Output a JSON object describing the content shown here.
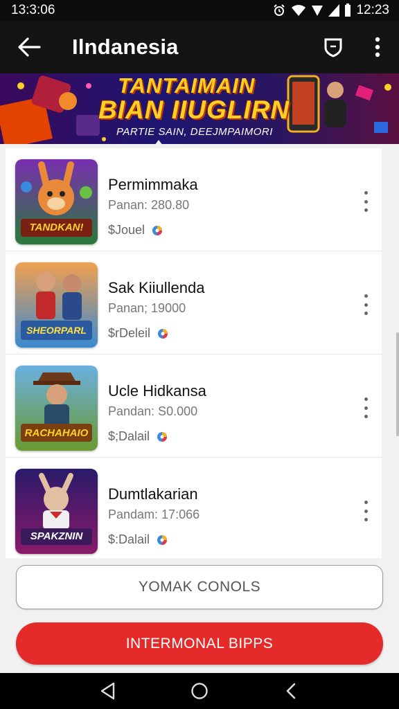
{
  "status_bar": {
    "time_left": "13:3:06",
    "time_right": "12:23",
    "icons": [
      "alarm-icon",
      "wifi-icon",
      "signal-icon",
      "signal-bars-icon",
      "battery-icon"
    ]
  },
  "app_bar": {
    "title": "Ilndanesia",
    "back_icon": "arrow-left-icon",
    "shield_icon": "shield-icon",
    "more_icon": "more-vertical-icon"
  },
  "banner": {
    "line1": "TANTAIMAIN",
    "line2": "BIAN IIUGLIRN",
    "line3": "PARTIE SAIN, DEEJMPAIMORI"
  },
  "games": [
    {
      "title": "Permimmaka",
      "subtitle": "Panan: 280.80",
      "detail": "$Jouel",
      "art_text": "TANDKAN!"
    },
    {
      "title": "Sak Kiiullenda",
      "subtitle": "Panan; 19000",
      "detail": "$rDeleil",
      "art_text": "SHEORPARL"
    },
    {
      "title": "Ucle Hidkansa",
      "subtitle": "Pandan: S0.000",
      "detail": "$;Dalail",
      "art_text": "RACHAHAIO"
    },
    {
      "title": "Dumtlakarian",
      "subtitle": "Pandam: 17:066",
      "detail": "$:Dalail",
      "art_text": "SPAKZNIN"
    }
  ],
  "buttons": {
    "secondary": "YOMAK CONOLS",
    "primary": "INTERMONAL BIPPS"
  },
  "colors": {
    "primary_button": "#e52a2a",
    "app_bar": "#141414",
    "banner_text": "#ffd02a"
  },
  "nav": {
    "back_icon": "triangle-back-icon",
    "home_icon": "circle-home-icon",
    "recents_icon": "chevron-left-icon"
  }
}
